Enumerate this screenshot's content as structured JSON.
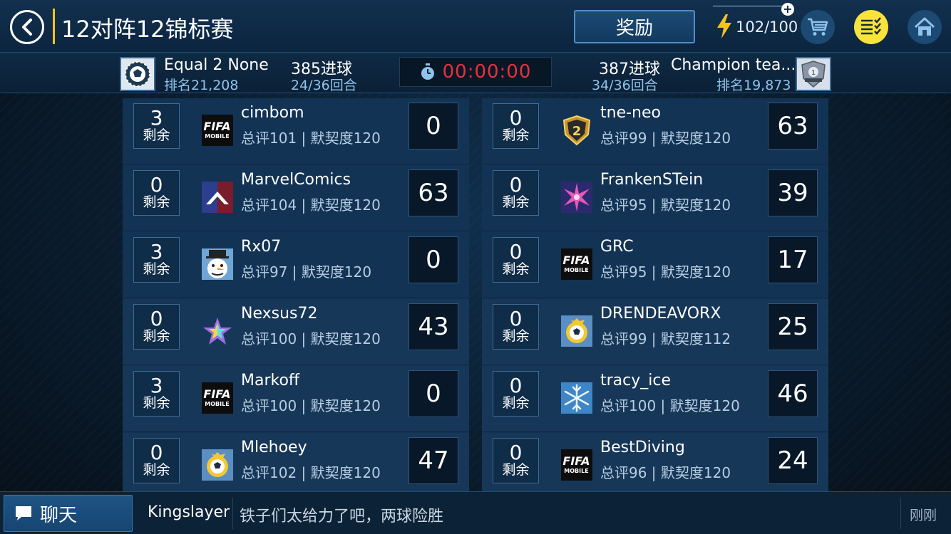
{
  "header": {
    "title": "12对阵12锦标赛",
    "reward_label": "奖励",
    "energy": "102/100"
  },
  "match": {
    "left_team": {
      "name": "Equal 2 None",
      "rank": "排名21,208",
      "goals": "385进球",
      "rounds": "24/36回合"
    },
    "right_team": {
      "name": "Champion tea...",
      "rank": "排名19,873",
      "goals": "387进球",
      "rounds": "34/36回合"
    },
    "timer": "00:00:00"
  },
  "remain_label": "剩余",
  "left_players": [
    {
      "remain": "3",
      "name": "cimbom",
      "stats": "总评101 | 默契度120",
      "score": "0",
      "avatar": "fifa-mobile-logo"
    },
    {
      "remain": "0",
      "name": "MarvelComics",
      "stats": "总评104 | 默契度120",
      "score": "63",
      "avatar": "chevron-badge"
    },
    {
      "remain": "3",
      "name": "Rx07",
      "stats": "总评97 | 默契度120",
      "score": "0",
      "avatar": "snowman"
    },
    {
      "remain": "0",
      "name": "Nexsus72",
      "stats": "总评100 | 默契度120",
      "score": "43",
      "avatar": "rainbow-star"
    },
    {
      "remain": "3",
      "name": "Markoff",
      "stats": "总评100 | 默契度120",
      "score": "0",
      "avatar": "fifa-mobile-logo"
    },
    {
      "remain": "0",
      "name": "Mlehoey",
      "stats": "总评102 | 默契度120",
      "score": "47",
      "avatar": "soccer-ball-badge"
    }
  ],
  "right_players": [
    {
      "remain": "0",
      "name": "tne-neo",
      "stats": "总评99 | 默契度120",
      "score": "63",
      "avatar": "gold-shield-2"
    },
    {
      "remain": "0",
      "name": "FrankenSTein",
      "stats": "总评95 | 默契度120",
      "score": "39",
      "avatar": "pink-star"
    },
    {
      "remain": "0",
      "name": "GRC",
      "stats": "总评95 | 默契度120",
      "score": "17",
      "avatar": "fifa-mobile-logo"
    },
    {
      "remain": "0",
      "name": "DRENDEAVORX",
      "stats": "总评99 | 默契度112",
      "score": "25",
      "avatar": "soccer-ball-badge"
    },
    {
      "remain": "0",
      "name": "tracy_ice",
      "stats": "总评100 | 默契度120",
      "score": "46",
      "avatar": "snowflake"
    },
    {
      "remain": "0",
      "name": "BestDiving",
      "stats": "总评96 | 默契度120",
      "score": "24",
      "avatar": "fifa-mobile-logo"
    }
  ],
  "chat": {
    "button_label": "聊天",
    "user": "Kingslayer",
    "message": "铁子们太给力了吧，两球险胜",
    "time": "刚刚"
  },
  "icons": {
    "fifa_top": "FIFA",
    "fifa_bottom": "MOBILE",
    "shield_number": "2",
    "right_badge_number": "1"
  },
  "colors": {
    "timer": "#e7313f",
    "energy_bolt": "#f5c518",
    "tasks_button": "#f7e33b",
    "accent_blue": "#8fc3ec"
  }
}
